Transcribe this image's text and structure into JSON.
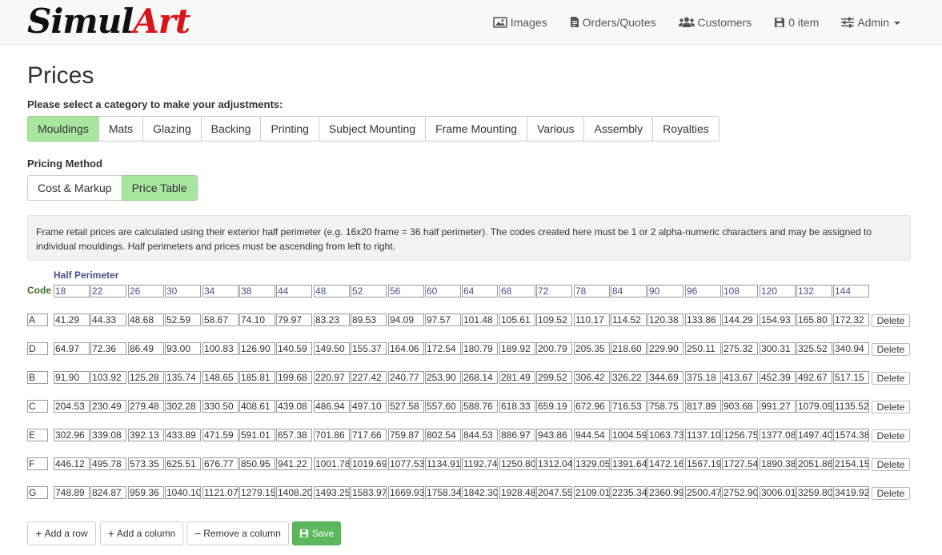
{
  "brand": {
    "part1": "Simul",
    "part2": "Art"
  },
  "nav": {
    "images": "Images",
    "orders": "Orders/Quotes",
    "customers": "Customers",
    "cart": "0 item",
    "admin": "Admin"
  },
  "page": {
    "title": "Prices",
    "category_prompt": "Please select a category to make your adjustments:",
    "pricing_method_label": "Pricing Method"
  },
  "categories": [
    "Mouldings",
    "Mats",
    "Glazing",
    "Backing",
    "Printing",
    "Subject Mounting",
    "Frame Mounting",
    "Various",
    "Assembly",
    "Royalties"
  ],
  "active_category": "Mouldings",
  "methods": [
    "Cost & Markup",
    "Price Table"
  ],
  "active_method": "Price Table",
  "info_text": "Frame retail prices are calculated using their exterior half perimeter (e.g. 16x20 frame = 36 half perimeter). The codes created here must be 1 or 2 alpha-numeric characters and may be assigned to individual mouldings. Half perimeters and prices must be ascending from left to right.",
  "table": {
    "half_perimeter_label": "Half Perimeter",
    "code_label": "Code",
    "delete_label": "Delete",
    "half_perimeters": [
      "18",
      "22",
      "26",
      "30",
      "34",
      "38",
      "44",
      "48",
      "52",
      "56",
      "60",
      "64",
      "68",
      "72",
      "78",
      "84",
      "90",
      "96",
      "108",
      "120",
      "132",
      "144"
    ],
    "rows": [
      {
        "code": "A",
        "prices": [
          "41.29",
          "44.33",
          "48.68",
          "52.59",
          "58.67",
          "74.10",
          "79.97",
          "83.23",
          "89.53",
          "94.09",
          "97.57",
          "101.48",
          "105.61",
          "109.52",
          "110.17",
          "114.52",
          "120.38",
          "133.86",
          "144.29",
          "154.93",
          "165.80",
          "172.32"
        ]
      },
      {
        "code": "D",
        "prices": [
          "64.97",
          "72.36",
          "86.49",
          "93.00",
          "100.83",
          "126.90",
          "140.59",
          "149.50",
          "155.37",
          "164.06",
          "172.54",
          "180.79",
          "189.92",
          "200.79",
          "205.35",
          "218.60",
          "229.90",
          "250.11",
          "275.32",
          "300.31",
          "325.52",
          "340.94"
        ]
      },
      {
        "code": "B",
        "prices": [
          "91.90",
          "103.92",
          "125.28",
          "135.74",
          "148.65",
          "185.81",
          "199.68",
          "220.97",
          "227.42",
          "240.77",
          "253.90",
          "268.14",
          "281.49",
          "299.52",
          "306.42",
          "326.22",
          "344.69",
          "375.18",
          "413.67",
          "452.39",
          "492.67",
          "517.15"
        ]
      },
      {
        "code": "C",
        "prices": [
          "204.53",
          "230.49",
          "279.48",
          "302.28",
          "330.50",
          "408.61",
          "439.08",
          "486.94",
          "497.10",
          "527.58",
          "557.60",
          "588.76",
          "618.33",
          "659.19",
          "672.96",
          "716.53",
          "758.75",
          "817.89",
          "903.68",
          "991.27",
          "1079.09",
          "1135.52"
        ]
      },
      {
        "code": "E",
        "prices": [
          "302.96",
          "339.08",
          "392.13",
          "433.89",
          "471.59",
          "591.01",
          "657.38",
          "701.86",
          "717.66",
          "759.87",
          "802.54",
          "844.53",
          "886.97",
          "943.86",
          "944.54",
          "1004.59",
          "1063.73",
          "1137.10",
          "1256.75",
          "1377.08",
          "1497.40",
          "1574.38"
        ]
      },
      {
        "code": "F",
        "prices": [
          "446.12",
          "495.78",
          "573.35",
          "625.51",
          "676.77",
          "850.95",
          "941.22",
          "1001.78",
          "1019.69",
          "1077.53",
          "1134.91",
          "1192.74",
          "1250.80",
          "1312.04",
          "1329.05",
          "1391.64",
          "1472.16",
          "1567.19",
          "1727.54",
          "1890.38",
          "2051.86",
          "2154.15"
        ]
      },
      {
        "code": "G",
        "prices": [
          "748.89",
          "824.87",
          "959.36",
          "1040.10",
          "1121.07",
          "1279.15",
          "1408.20",
          "1493.25",
          "1583.97",
          "1669.93",
          "1758.34",
          "1842.30",
          "1928.48",
          "2047.55",
          "2109.01",
          "2235.34",
          "2360.99",
          "2500.47",
          "2752.90",
          "3006.01",
          "3259.80",
          "3419.92"
        ]
      }
    ]
  },
  "actions": {
    "add_row": "Add a row",
    "add_column": "Add a column",
    "remove_column": "Remove a column",
    "save": "Save"
  },
  "colors": {
    "active_green": "#a8e6a0",
    "save_green": "#5cb85c",
    "brand_red": "#d9141b",
    "hp_blue": "#4a4f8a",
    "code_green": "#3c6b2a"
  },
  "icons": {
    "images": "image-icon",
    "orders": "document-icon",
    "customers": "users-icon",
    "cart": "floppy-disk-icon",
    "admin": "sliders-icon",
    "save": "floppy-disk-icon"
  }
}
